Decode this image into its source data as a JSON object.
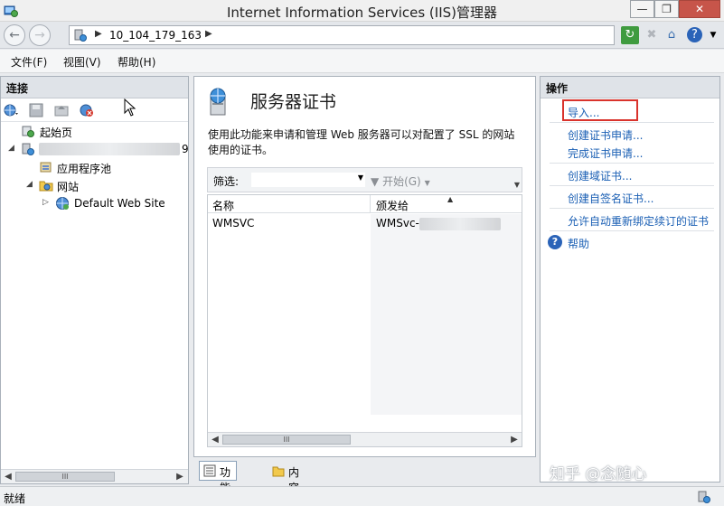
{
  "window": {
    "title": "Internet Information Services (IIS)管理器",
    "minimize": "—",
    "maximize": "❐",
    "close": "✕"
  },
  "address": {
    "path": "10_104_179_163"
  },
  "menu": {
    "items": [
      "文件(F)",
      "视图(V)",
      "帮助(H)"
    ]
  },
  "connections": {
    "header": "连接",
    "tree": [
      {
        "label": "起始页"
      },
      {
        "label": "",
        "redacted": true,
        "suffix": "9"
      },
      {
        "label": "应用程序池"
      },
      {
        "label": "网站"
      },
      {
        "label": "Default Web Site"
      }
    ]
  },
  "feature": {
    "title": "服务器证书",
    "description": "使用此功能来申请和管理 Web 服务器可以对配置了 SSL 的网站使用的证书。",
    "filter_label": "筛选:",
    "start_label": "开始(G)",
    "columns": [
      "名称",
      "颁发给"
    ],
    "rows": [
      {
        "name": "WMSVC",
        "issued_to": "WMSvc-"
      }
    ]
  },
  "view_tabs": {
    "feature_view": "功能视图",
    "content_view": "内容视图"
  },
  "actions": {
    "header": "操作",
    "items": [
      {
        "label": "导入...",
        "highlighted": true
      },
      {
        "label": "创建证书申请..."
      },
      {
        "label": "完成证书申请..."
      },
      {
        "label": "创建域证书..."
      },
      {
        "label": "创建自签名证书..."
      },
      {
        "label": "允许自动重新绑定续订的证书"
      }
    ],
    "help": "帮助"
  },
  "watermark": "知乎 @念随心",
  "status": {
    "text": "就绪"
  },
  "scroll_thumb": "III",
  "colors": {
    "link": "#1a5fb4",
    "highlight": "#d9332c",
    "panel_header": "#dfe3e8",
    "close_button": "#c7554a"
  }
}
